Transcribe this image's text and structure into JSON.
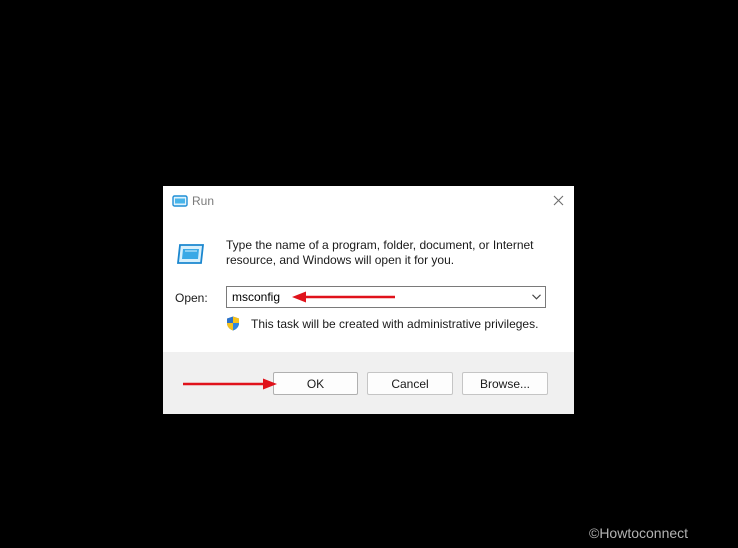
{
  "window": {
    "title": "Run",
    "close_glyph": "✕"
  },
  "dialog": {
    "description": "Type the name of a program, folder, document, or Internet resource, and Windows will open it for you.",
    "open_label": "Open:",
    "open_value": "msconfig",
    "admin_note": "This task will be created with administrative privileges."
  },
  "buttons": {
    "ok": "OK",
    "cancel": "Cancel",
    "browse": "Browse..."
  },
  "annotations": {
    "arrow_color": "#e0121b"
  },
  "watermark": "©Howtoconnect",
  "colors": {
    "background": "#000000",
    "dialog": "#ffffff",
    "footer": "#f0f0f0",
    "icon_blue": "#1f8fd6"
  },
  "icons": [
    "run-app-icon",
    "close-icon",
    "chevron-down-icon",
    "uac-shield-icon",
    "red-arrow"
  ]
}
